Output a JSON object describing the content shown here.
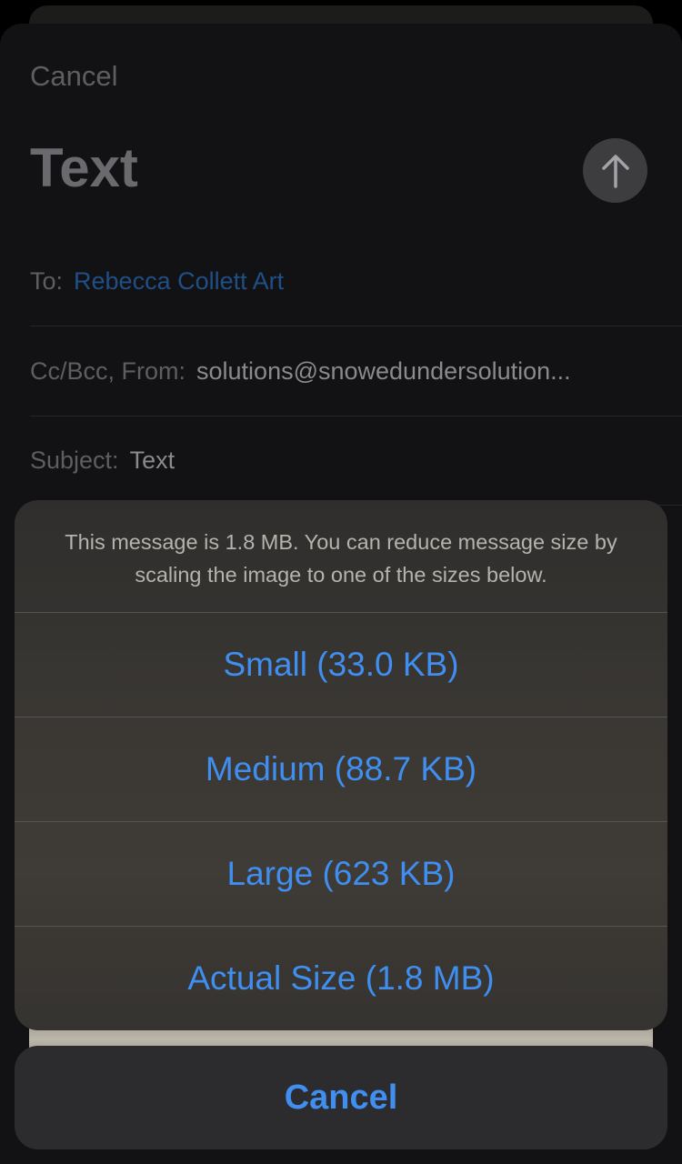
{
  "compose": {
    "cancel_label": "Cancel",
    "title": "Text",
    "send_icon": "arrow-up-icon",
    "to_label": "To:",
    "to_value": "Rebecca Collett Art",
    "ccbcc_label": "Cc/Bcc, From:",
    "from_value": "solutions@snowedundersolution...",
    "subject_label": "Subject:",
    "subject_value": "Text"
  },
  "action_sheet": {
    "message": "This message is 1.8 MB. You can reduce message size by scaling the image to one of the sizes below.",
    "options": [
      {
        "label": "Small (33.0 KB)"
      },
      {
        "label": "Medium (88.7 KB)"
      },
      {
        "label": "Large (623 KB)"
      },
      {
        "label": "Actual Size (1.8 MB)"
      }
    ],
    "cancel_label": "Cancel"
  },
  "colors": {
    "accent": "#3f8ef0",
    "link_dim": "#1f4f86",
    "background": "#121214"
  }
}
